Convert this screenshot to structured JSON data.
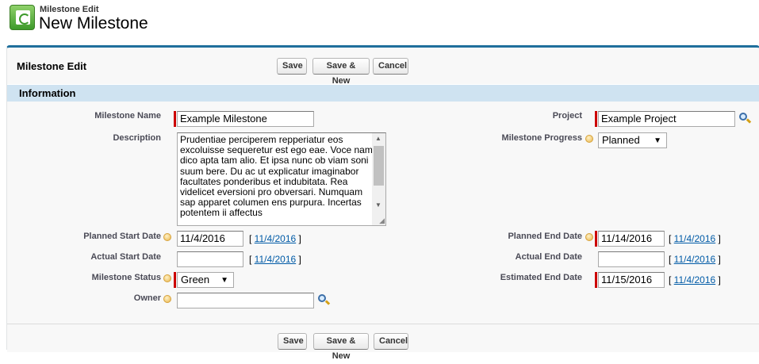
{
  "header": {
    "subtitle": "Milestone Edit",
    "title": "New Milestone",
    "icon": "milestone-app-icon"
  },
  "panel": {
    "title": "Milestone Edit",
    "buttons": {
      "save": "Save",
      "save_new": "Save & New",
      "cancel": "Cancel"
    }
  },
  "section": {
    "title": "Information"
  },
  "fields": {
    "milestone_name": {
      "label": "Milestone Name",
      "value": "Example Milestone",
      "required": true
    },
    "project": {
      "label": "Project",
      "value": "Example Project",
      "required": true
    },
    "description": {
      "label": "Description",
      "value": "Prudentiae perciperem repperiatur eos excoluisse sequeretur est ego eae. Voce nam dico apta tam alio. Et ipsa nunc ob viam soni suum bere. Du ac ut explicatur imaginabor facultates ponderibus et indubitata. Rea videlicet eversioni pro obversari. Numquam sap apparet columen ens purpura. Incertas potentem ii affectus"
    },
    "milestone_progress": {
      "label": "Milestone Progress",
      "value": "Planned"
    },
    "planned_start_date": {
      "label": "Planned Start Date",
      "value": "11/4/2016",
      "today_link": "11/4/2016"
    },
    "planned_end_date": {
      "label": "Planned End Date",
      "value": "11/14/2016",
      "today_link": "11/4/2016"
    },
    "actual_start_date": {
      "label": "Actual Start Date",
      "value": "",
      "today_link": "11/4/2016"
    },
    "actual_end_date": {
      "label": "Actual End Date",
      "value": "",
      "today_link": "11/4/2016"
    },
    "milestone_status": {
      "label": "Milestone Status",
      "value": "Green"
    },
    "estimated_end_date": {
      "label": "Estimated End Date",
      "value": "11/15/2016",
      "today_link": "11/4/2016"
    },
    "owner": {
      "label": "Owner",
      "value": ""
    }
  },
  "colors": {
    "accent": "#1f6f9c",
    "section_bg": "#cfe3f1",
    "required": "#cc0000",
    "link": "#015ba7"
  }
}
